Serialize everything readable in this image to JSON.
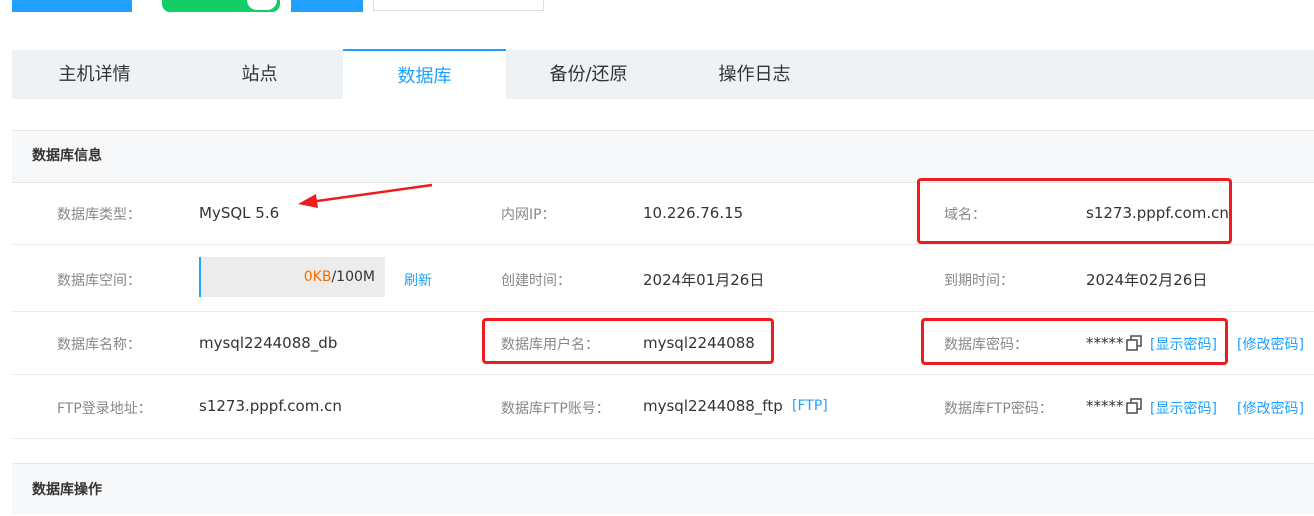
{
  "tabs": [
    "主机详情",
    "站点",
    "数据库",
    "备份/还原",
    "操作日志"
  ],
  "active_tab": "数据库",
  "section_title": "数据库信息",
  "info": {
    "db_type_label": "数据库类型：",
    "db_type_value": "MySQL 5.6",
    "internal_ip_label": "内网IP：",
    "internal_ip_value": "10.226.76.15",
    "domain_label": "域名：",
    "domain_value": "s1273.pppf.com.cn",
    "db_space_label": "数据库空间：",
    "db_space_used": "0KB",
    "db_space_total": "/100M",
    "db_space_used_fraction": 0,
    "refresh_link": "刷新",
    "created_label": "创建时间：",
    "created_value": "2024年01月26日",
    "expire_label": "到期时间：",
    "expire_value": "2024年02月26日",
    "db_name_label": "数据库名称：",
    "db_name_value": "mysql2244088_db",
    "db_user_label": "数据库用户名：",
    "db_user_value": "mysql2244088",
    "db_password_label": "数据库密码：",
    "db_password_value": "*****",
    "show_password_link": "[显示密码]",
    "change_password_link": "[修改密码]",
    "ftp_addr_label": "FTP登录地址：",
    "ftp_addr_value": "s1273.pppf.com.cn",
    "ftp_account_label": "数据库FTP账号：",
    "ftp_account_value": "mysql2244088_ftp",
    "ftp_link": "[FTP]",
    "ftp_password_label": "数据库FTP密码：",
    "ftp_password_value": "*****",
    "ftp_show_password_link": "[显示密码]",
    "ftp_change_password_link": "[修改密码]"
  },
  "section2_title": "数据库操作",
  "colors": {
    "accent": "#20a0ff",
    "toggle_on": "#13ce66",
    "annotation_red": "#ee1c1c",
    "used_space": "#ff6a00"
  },
  "icons": {
    "copy": "copy-icon",
    "arrow": "annotation-arrow"
  }
}
